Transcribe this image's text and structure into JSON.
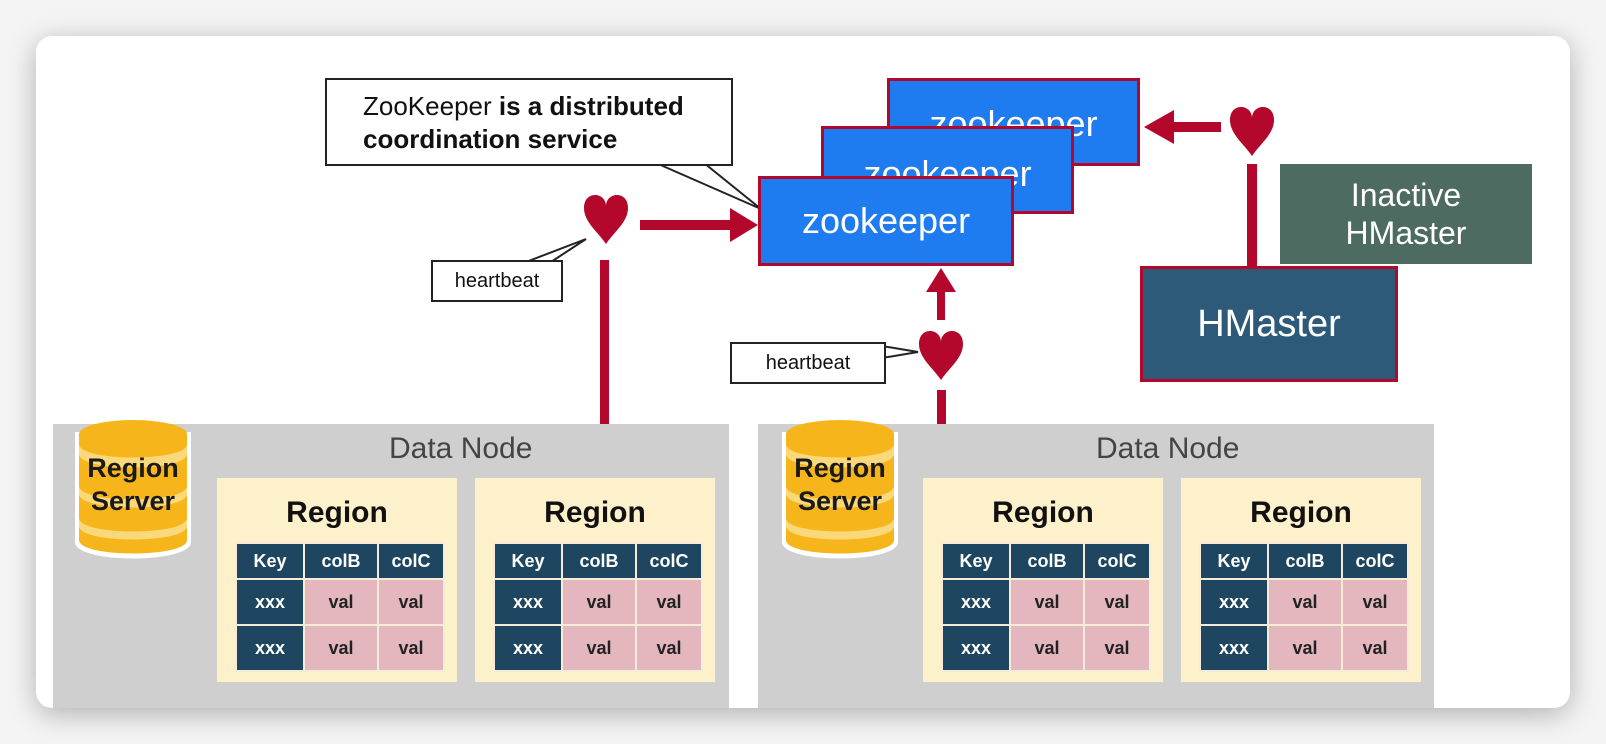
{
  "diagram": {
    "callout_main": {
      "text_normal": "ZooKeeper",
      "text_bold": "is a distributed",
      "line2": "coordination service"
    },
    "heartbeat_labels": [
      "heartbeat",
      "heartbeat"
    ],
    "zookeeper_nodes": [
      "zookeeper",
      "zookeeper",
      "zookeeper"
    ],
    "hmaster_active": "HMaster",
    "hmaster_inactive": {
      "line1": "Inactive",
      "line2": "HMaster"
    },
    "colors": {
      "zookeeper_fill": "#1e7bf0",
      "accent_red": "#b4072c",
      "hmaster_fill": "#2d5a78",
      "inactive_fill": "#4e6b62",
      "datanode_fill": "#cfcfcf",
      "region_fill": "#fdf1cc",
      "region_server_fill": "#f7b51c",
      "table_header_fill": "#1f4660",
      "table_value_fill": "#e4b7bf"
    },
    "data_nodes": [
      {
        "title": "Data Node",
        "region_server": {
          "line1": "Region",
          "line2": "Server"
        },
        "regions": [
          {
            "title": "Region",
            "headers": [
              "Key",
              "colB",
              "colC"
            ],
            "rows": [
              [
                "xxx",
                "val",
                "val"
              ],
              [
                "xxx",
                "val",
                "val"
              ]
            ]
          },
          {
            "title": "Region",
            "headers": [
              "Key",
              "colB",
              "colC"
            ],
            "rows": [
              [
                "xxx",
                "val",
                "val"
              ],
              [
                "xxx",
                "val",
                "val"
              ]
            ]
          }
        ]
      },
      {
        "title": "Data Node",
        "region_server": {
          "line1": "Region",
          "line2": "Server"
        },
        "regions": [
          {
            "title": "Region",
            "headers": [
              "Key",
              "colB",
              "colC"
            ],
            "rows": [
              [
                "xxx",
                "val",
                "val"
              ],
              [
                "xxx",
                "val",
                "val"
              ]
            ]
          },
          {
            "title": "Region",
            "headers": [
              "Key",
              "colB",
              "colC"
            ],
            "rows": [
              [
                "xxx",
                "val",
                "val"
              ],
              [
                "xxx",
                "val",
                "val"
              ]
            ]
          }
        ]
      }
    ]
  }
}
